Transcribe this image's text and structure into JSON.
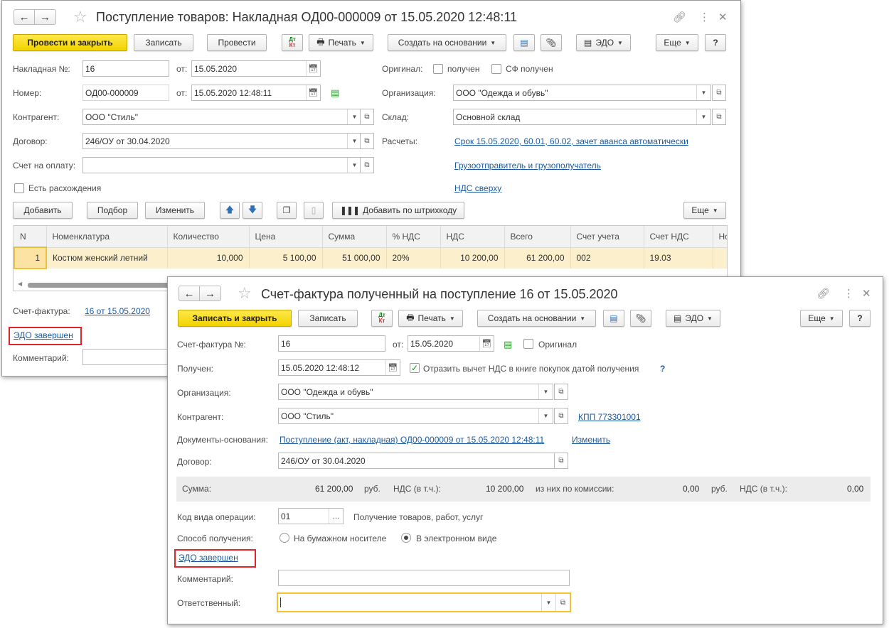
{
  "win1": {
    "title": "Поступление товаров: Накладная ОД00-000009 от 15.05.2020 12:48:11",
    "toolbar": {
      "post_close": "Провести и закрыть",
      "save": "Записать",
      "post": "Провести",
      "dtkt_top": "Дт",
      "dtkt_bottom": "Кт",
      "print": "Печать",
      "create_based": "Создать на основании",
      "edo": "ЭДО",
      "more": "Еще",
      "help": "?"
    },
    "form": {
      "invoice_no_label": "Накладная №:",
      "invoice_no": "16",
      "from_label": "от:",
      "invoice_date": "15.05.2020",
      "number_label": "Номер:",
      "number": "ОД00-000009",
      "number_datetime": "15.05.2020 12:48:11",
      "counterparty_label": "Контрагент:",
      "counterparty": "ООО \"Стиль\"",
      "contract_label": "Договор:",
      "contract": "246/ОУ от 30.04.2020",
      "payment_invoice_label": "Счет на оплату:",
      "payment_invoice": "",
      "discrepancy_label": "Есть расхождения",
      "original_label": "Оригинал:",
      "received_label": "получен",
      "sf_received_label": "СФ получен",
      "org_label": "Организация:",
      "org": "ООО \"Одежда и обувь\"",
      "warehouse_label": "Склад:",
      "warehouse": "Основной склад",
      "settlements_label": "Расчеты:",
      "settlements_link": "Срок 15.05.2020, 60.01, 60.02, зачет аванса автоматически",
      "shipper_link": "Грузоотправитель и грузополучатель",
      "vat_link": "НДС сверху"
    },
    "table_toolbar": {
      "add": "Добавить",
      "select": "Подбор",
      "change": "Изменить",
      "barcode": "Добавить по штрихкоду",
      "more": "Еще"
    },
    "table": {
      "columns": [
        "N",
        "Номенклатура",
        "Количество",
        "Цена",
        "Сумма",
        "% НДС",
        "НДС",
        "Всего",
        "Счет учета",
        "Счет НДС",
        "Но"
      ],
      "rows": [
        [
          "1",
          "Костюм женский летний",
          "10,000",
          "5 100,00",
          "51 000,00",
          "20%",
          "10 200,00",
          "61 200,00",
          "002",
          "19.03",
          ""
        ]
      ]
    },
    "footer": {
      "sf_label": "Счет-фактура:",
      "sf_link": "16 от 15.05.2020",
      "edo_status": "ЭДО завершен",
      "comment_label": "Комментарий:"
    }
  },
  "win2": {
    "title": "Счет-фактура полученный на поступление 16 от 15.05.2020",
    "toolbar": {
      "save_close": "Записать и закрыть",
      "save": "Записать",
      "dtkt_top": "Дт",
      "dtkt_bottom": "Кт",
      "print": "Печать",
      "create_based": "Создать на основании",
      "edo": "ЭДО",
      "more": "Еще",
      "help": "?"
    },
    "form": {
      "sf_no_label": "Счет-фактура №:",
      "sf_no": "16",
      "from_label": "от:",
      "sf_date": "15.05.2020",
      "original_label": "Оригинал",
      "received_label": "Получен:",
      "received_datetime": "15.05.2020 12:48:12",
      "reflect_label": "Отразить вычет НДС в книге покупок датой получения",
      "question": "?",
      "org_label": "Организация:",
      "org": "ООО \"Одежда и обувь\"",
      "counterparty_label": "Контрагент:",
      "counterparty": "ООО \"Стиль\"",
      "kpp_link": "КПП 773301001",
      "basis_label": "Документы-основания:",
      "basis_link": "Поступление (акт, накладная) ОД00-000009 от 15.05.2020 12:48:11",
      "change_link": "Изменить",
      "contract_label": "Договор:",
      "contract": "246/ОУ от 30.04.2020"
    },
    "summary": {
      "sum_label": "Сумма:",
      "sum": "61 200,00",
      "currency": "руб.",
      "vat_label": "НДС (в т.ч.):",
      "vat": "10 200,00",
      "commission_label": "из них по комиссии:",
      "commission": "0,00",
      "currency2": "руб.",
      "vat2_label": "НДС (в т.ч.):",
      "vat2": "0,00"
    },
    "form2": {
      "opcode_label": "Код вида операции:",
      "opcode": "01",
      "opcode_desc": "Получение товаров, работ, услуг",
      "receipt_method_label": "Способ получения:",
      "paper": "На бумажном носителе",
      "electronic": "В электронном виде",
      "edo_status": "ЭДО завершен",
      "comment_label": "Комментарий:",
      "comment": "",
      "responsible_label": "Ответственный:",
      "responsible": ""
    }
  }
}
